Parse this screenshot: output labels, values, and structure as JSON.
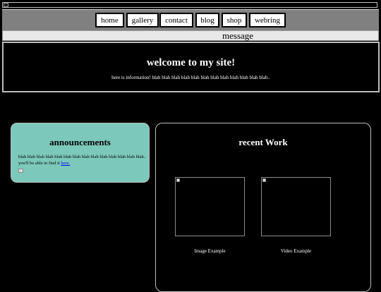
{
  "nav": {
    "items": [
      "home",
      "gallery",
      "contact",
      "blog",
      "shop",
      "webring"
    ]
  },
  "message": {
    "text": "message"
  },
  "welcome": {
    "title": "welcome to my site!",
    "body": "here is information! blah blah blah blah blah blah blah blah blah blah blah blah.."
  },
  "announcements": {
    "title": "announcements",
    "body": "blah blah blah blah blah blah blah blah blah blah blah blah blah blah.. you'll be able to find it",
    "link": "here."
  },
  "recent_work": {
    "title": "recent Work",
    "items": [
      {
        "alt": "",
        "caption": "Image Example"
      },
      {
        "alt": "",
        "caption": "Video Example"
      }
    ]
  },
  "colors": {
    "background": "#000000",
    "nav_bar": "#808080",
    "announcements_bg": "#7cc9bb",
    "link": "#0000ee"
  },
  "icons": [
    "broken-image-icon"
  ]
}
